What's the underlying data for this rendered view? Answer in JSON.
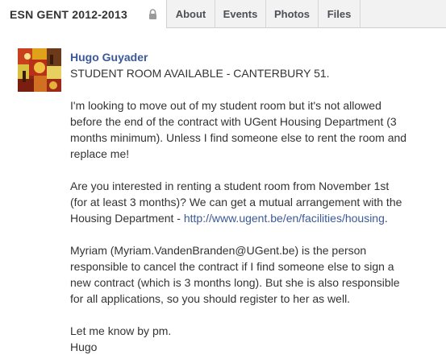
{
  "header": {
    "group_title": "ESN GENT 2012-2013",
    "tabs": [
      "About",
      "Events",
      "Photos",
      "Files"
    ]
  },
  "post": {
    "author": "Hugo Guyader",
    "headline": "STUDENT ROOM AVAILABLE - CANTERBURY 51.",
    "paragraph1": [
      "I'm looking to move out of my student room but it's not allowed",
      "before the end of the contract with UGent Housing Department (3",
      "months minimum). Unless I find someone else to rent the room and",
      "replace me!"
    ],
    "paragraph2": [
      "Are you interested in renting a student room from November 1st",
      "(for at least 3 months)? We can get a mutual arrangement with the"
    ],
    "paragraph2_last_prefix": "Housing Department - ",
    "housing_link": "http://www.ugent.be/en/facilities/housing",
    "paragraph2_last_suffix": ".",
    "paragraph3": [
      "Myriam (Myriam.VandenBranden@UGent.be) is the person",
      "responsible to cancel the contract if I find someone else to sign a",
      "new contract (which is 3 months long). But she is also responsible",
      "for all applications, so you should register to her as well."
    ],
    "sign_off": [
      "Let me know by pm.",
      "Hugo"
    ]
  },
  "colors": {
    "link": "#3b5998",
    "text": "#333333",
    "tabbar_bg": "#f2f2f2"
  },
  "icons": {
    "lock": "lock-icon"
  }
}
